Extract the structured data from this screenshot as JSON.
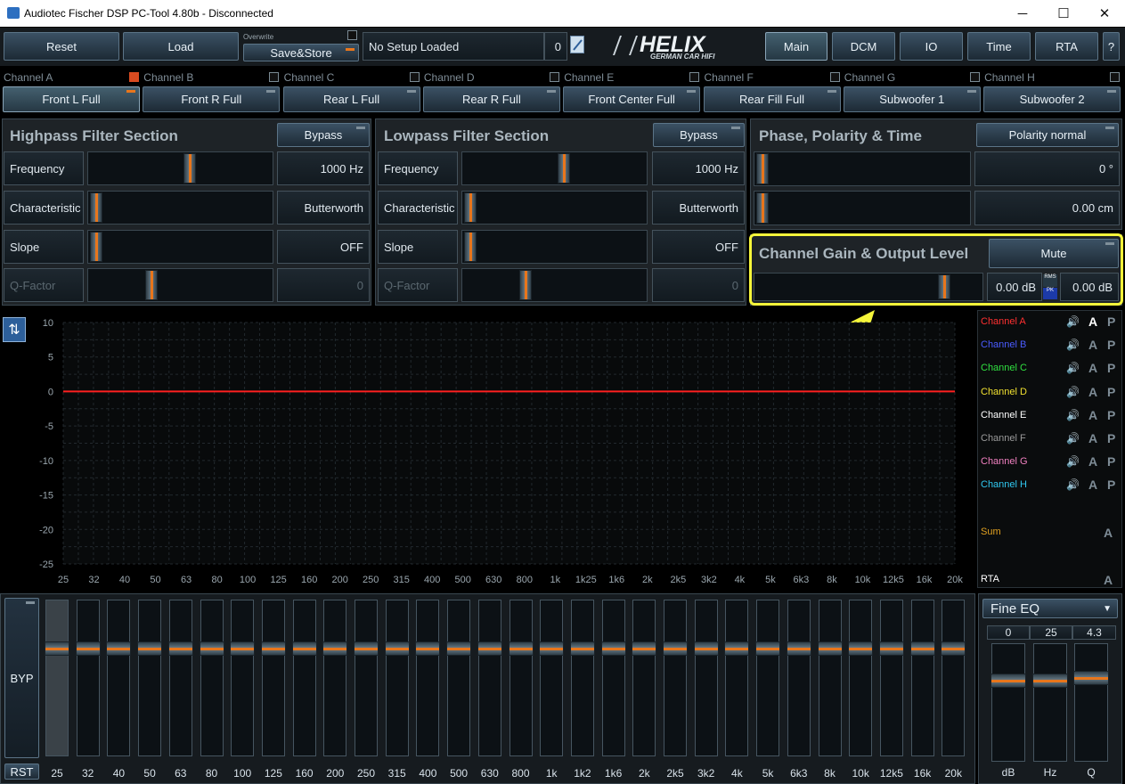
{
  "window": {
    "title": "Audiotec Fischer DSP PC-Tool 4.80b - Disconnected",
    "minimize": "─",
    "maximize": "☐",
    "close": "✕"
  },
  "toolbar": {
    "reset": "Reset",
    "load": "Load",
    "overwrite": "Overwrite",
    "save_store": "Save&Store",
    "setup_name": "No Setup Loaded",
    "setup_num": "0",
    "logo_main": "HELIX",
    "logo_sub": "GERMAN CAR HIFI",
    "tabs": [
      "Main",
      "DCM",
      "IO",
      "Time",
      "RTA",
      "?"
    ]
  },
  "channels": {
    "labels": [
      "Channel A",
      "Channel B",
      "Channel C",
      "Channel D",
      "Channel E",
      "Channel F",
      "Channel G",
      "Channel H"
    ],
    "names": [
      "Front L Full",
      "Front R Full",
      "Rear L Full",
      "Rear R Full",
      "Front Center Full",
      "Rear Fill Full",
      "Subwoofer 1",
      "Subwoofer 2"
    ]
  },
  "highpass": {
    "title": "Highpass Filter Section",
    "bypass": "Bypass",
    "rows": [
      {
        "label": "Frequency",
        "value": "1000 Hz"
      },
      {
        "label": "Characteristic",
        "value": "Butterworth"
      },
      {
        "label": "Slope",
        "value": "OFF"
      },
      {
        "label": "Q-Factor",
        "value": "0"
      }
    ]
  },
  "lowpass": {
    "title": "Lowpass Filter Section",
    "bypass": "Bypass",
    "rows": [
      {
        "label": "Frequency",
        "value": "1000 Hz"
      },
      {
        "label": "Characteristic",
        "value": "Butterworth"
      },
      {
        "label": "Slope",
        "value": "OFF"
      },
      {
        "label": "Q-Factor",
        "value": "0"
      }
    ]
  },
  "phase": {
    "title": "Phase, Polarity & Time",
    "polarity": "Polarity normal",
    "phase_value": "0 °",
    "time_value": "0.00 cm"
  },
  "gain": {
    "title": "Channel Gain & Output Level",
    "mute": "Mute",
    "gain_value": "0.00 dB",
    "rms": "RMS",
    "pk": "PK",
    "output_value": "0.00 dB"
  },
  "graph": {
    "y_ticks": [
      "10",
      "5",
      "0",
      "-5",
      "-10",
      "-15",
      "-20",
      "-25"
    ],
    "x_ticks": [
      "25",
      "32",
      "40",
      "50",
      "63",
      "80",
      "100",
      "125",
      "160",
      "200",
      "250",
      "315",
      "400",
      "500",
      "630",
      "800",
      "1k",
      "1k25",
      "1k6",
      "2k",
      "2k5",
      "3k2",
      "4k",
      "5k",
      "6k3",
      "8k",
      "10k",
      "12k5",
      "16k",
      "20k"
    ]
  },
  "legend": {
    "channels": [
      {
        "name": "Channel A",
        "color": "#ff3030"
      },
      {
        "name": "Channel B",
        "color": "#4a5cff"
      },
      {
        "name": "Channel C",
        "color": "#30e040"
      },
      {
        "name": "Channel D",
        "color": "#f0e030"
      },
      {
        "name": "Channel E",
        "color": "#ffffff"
      },
      {
        "name": "Channel F",
        "color": "#9a9a9a"
      },
      {
        "name": "Channel G",
        "color": "#f080c0"
      },
      {
        "name": "Channel H",
        "color": "#30c8f0"
      }
    ],
    "a": "A",
    "p": "P",
    "sum": "Sum",
    "rta": "RTA"
  },
  "eq": {
    "byp": "BYP",
    "rst": "RST",
    "bands": [
      "25",
      "32",
      "40",
      "50",
      "63",
      "80",
      "100",
      "125",
      "160",
      "200",
      "250",
      "315",
      "400",
      "500",
      "630",
      "800",
      "1k",
      "1k2",
      "1k6",
      "2k",
      "2k5",
      "3k2",
      "4k",
      "5k",
      "6k3",
      "8k",
      "10k",
      "12k5",
      "16k",
      "20k"
    ]
  },
  "fine_eq": {
    "title": "Fine EQ",
    "values": [
      "0",
      "25",
      "4.3"
    ],
    "labels": [
      "dB",
      "Hz",
      "Q"
    ]
  },
  "colors": {
    "accent": "#e8761c",
    "highlight": "#f5f53a",
    "curve": "#ff2020"
  }
}
